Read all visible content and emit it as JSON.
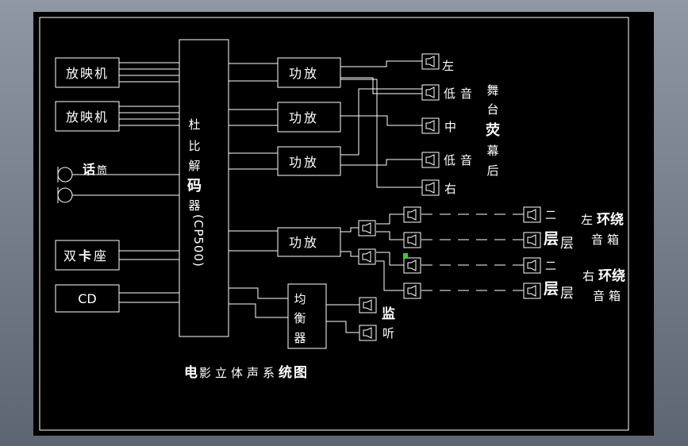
{
  "colors": {
    "canvas": "#000000",
    "line": "#ffffff",
    "marker": "#22dd22",
    "frame_bg": "#7d8692"
  },
  "title": {
    "chars": [
      {
        "t": "电",
        "bold": true
      },
      {
        "t": "影",
        "bold": false
      },
      {
        "t": "立",
        "bold": false
      },
      {
        "t": "体",
        "bold": false
      },
      {
        "t": "声",
        "bold": false
      },
      {
        "t": "系",
        "bold": false
      },
      {
        "t": "统",
        "bold": true
      },
      {
        "t": "图",
        "bold": true
      }
    ]
  },
  "sources": {
    "projector1": "放映机",
    "projector2": "放映机",
    "mic_a": "话",
    "mic_b": "筒",
    "cassette_a": "双",
    "cassette_b": "卡",
    "cassette_c": "座",
    "cd": "CD"
  },
  "decoder": {
    "c1": "杜",
    "c2": "比",
    "c3": "解",
    "c4": "码",
    "c5": "器",
    "c6": "(CP500)"
  },
  "amplifiers": [
    "功放",
    "功放",
    "功放",
    "功放"
  ],
  "equalizer": {
    "c1": "均",
    "c2": "衡",
    "c3": "器"
  },
  "stage_speakers": {
    "left": "左",
    "low1": "低音",
    "mid": "中",
    "low2": "低音",
    "right": "右"
  },
  "stage_label": {
    "c1": "舞",
    "c2": "台",
    "c3": "荧",
    "c4": "幕",
    "c5": "后"
  },
  "floor_labels": {
    "two_a": "二",
    "floor_a1": "层",
    "floor_a2": "层",
    "two_b": "二",
    "floor_b1": "层",
    "floor_b2": "层"
  },
  "left_surround": {
    "side": "左",
    "name": "环绕",
    "box": "音箱"
  },
  "right_surround": {
    "side": "右",
    "name": "环绕",
    "box": "音箱"
  },
  "monitor": {
    "c1": "监",
    "c2": "听"
  }
}
